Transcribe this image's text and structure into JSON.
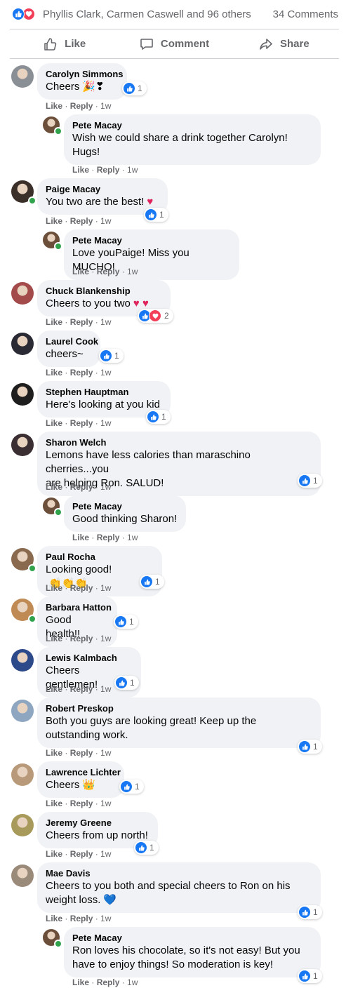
{
  "summary": {
    "reactors": "Phyllis Clark, Carmen Caswell and 96 others",
    "comments": "34 Comments"
  },
  "actions": {
    "like": "Like",
    "comment": "Comment",
    "share": "Share"
  },
  "meta": {
    "like": "Like",
    "dot": " · ",
    "reply": "Reply"
  },
  "colors": {
    "accent": "#1877f2",
    "love": "#f33e58",
    "bubble": "#f0f2f5",
    "muted": "#65676b",
    "online": "#31a24c"
  },
  "comments": [
    {
      "author": "Carolyn Simmons",
      "lines": [
        "Cheers"
      ],
      "emoji": "🎉❣",
      "time": "1w",
      "reactions": "1",
      "avatar": "#8a8f95",
      "online": false
    },
    {
      "author": "Pete Macay",
      "lines": [
        "Wish we could share a drink together Carolyn!",
        "Hugs!"
      ],
      "time": "1w",
      "avatar": "#6b4f3a",
      "online": true
    },
    {
      "author": "Paige Macay",
      "lines": [
        "You two are the best!"
      ],
      "emoji": "♥",
      "time": "1w",
      "reactions": "1",
      "avatar": "#3b2f2a",
      "online": true
    },
    {
      "author": "Pete Macay",
      "lines": [
        "Love youPaige! Miss you MUCHO!"
      ],
      "time": "1w",
      "avatar": "#6b4f3a",
      "online": true
    },
    {
      "author": "Chuck Blankenship",
      "lines": [
        "Cheers to you two"
      ],
      "emoji": "♥ ♥",
      "time": "1w",
      "reactions": "2",
      "avatar": "#a34a4a",
      "online": false
    },
    {
      "author": "Laurel Cook",
      "lines": [
        "cheers~"
      ],
      "time": "1w",
      "reactions": "1",
      "avatar": "#2a2a35",
      "online": false
    },
    {
      "author": "Stephen Hauptman",
      "lines": [
        "Here's looking at you kid"
      ],
      "time": "1w",
      "reactions": "1",
      "avatar": "#1e1e1e",
      "online": false
    },
    {
      "author": "Sharon Welch",
      "lines": [
        "Lemons have less calories than maraschino cherries...you",
        "are helping Ron. SALUD!"
      ],
      "time": "1w",
      "reactions": "1",
      "avatar": "#3a2e32",
      "online": false
    },
    {
      "author": "Pete Macay",
      "lines": [
        "Good thinking Sharon!"
      ],
      "time": "1w",
      "avatar": "#6b4f3a",
      "online": true
    },
    {
      "author": "Paul Rocha",
      "lines": [
        "Looking good!"
      ],
      "emoji": "👏👏👏",
      "time": "1w",
      "reactions": "1",
      "avatar": "#8a6a4f",
      "online": true
    },
    {
      "author": "Barbara Hatton",
      "lines": [
        "Good health!!"
      ],
      "time": "1w",
      "reactions": "1",
      "avatar": "#c08a55",
      "online": true
    },
    {
      "author": "Lewis Kalmbach",
      "lines": [
        "Cheers gentlemen!"
      ],
      "time": "1w",
      "reactions": "1",
      "avatar": "#2c4a8a",
      "online": false
    },
    {
      "author": "Robert Preskop",
      "lines": [
        "Both you guys are looking great! Keep up the",
        "outstanding work."
      ],
      "time": "1w",
      "reactions": "1",
      "avatar": "#8fa6c0",
      "online": false
    },
    {
      "author": "Lawrence Lichter",
      "lines": [
        "Cheers"
      ],
      "emoji": "👑",
      "time": "1w",
      "reactions": "1",
      "avatar": "#b89a7a",
      "online": false
    },
    {
      "author": "Jeremy Greene",
      "lines": [
        "Cheers from up north!"
      ],
      "time": "1w",
      "reactions": "1",
      "avatar": "#a89a5a",
      "online": false
    },
    {
      "author": "Mae Davis",
      "lines": [
        "Cheers to you both and special cheers to Ron on his",
        "weight loss."
      ],
      "emoji": "💙",
      "time": "1w",
      "reactions": "1",
      "avatar": "#9a8a7a",
      "online": false
    },
    {
      "author": "Pete Macay",
      "lines": [
        "Ron loves his chocolate, so it's not easy! But you",
        "have to enjoy things! So moderation is key!"
      ],
      "time": "1w",
      "reactions": "1",
      "avatar": "#6b4f3a",
      "online": true
    }
  ]
}
